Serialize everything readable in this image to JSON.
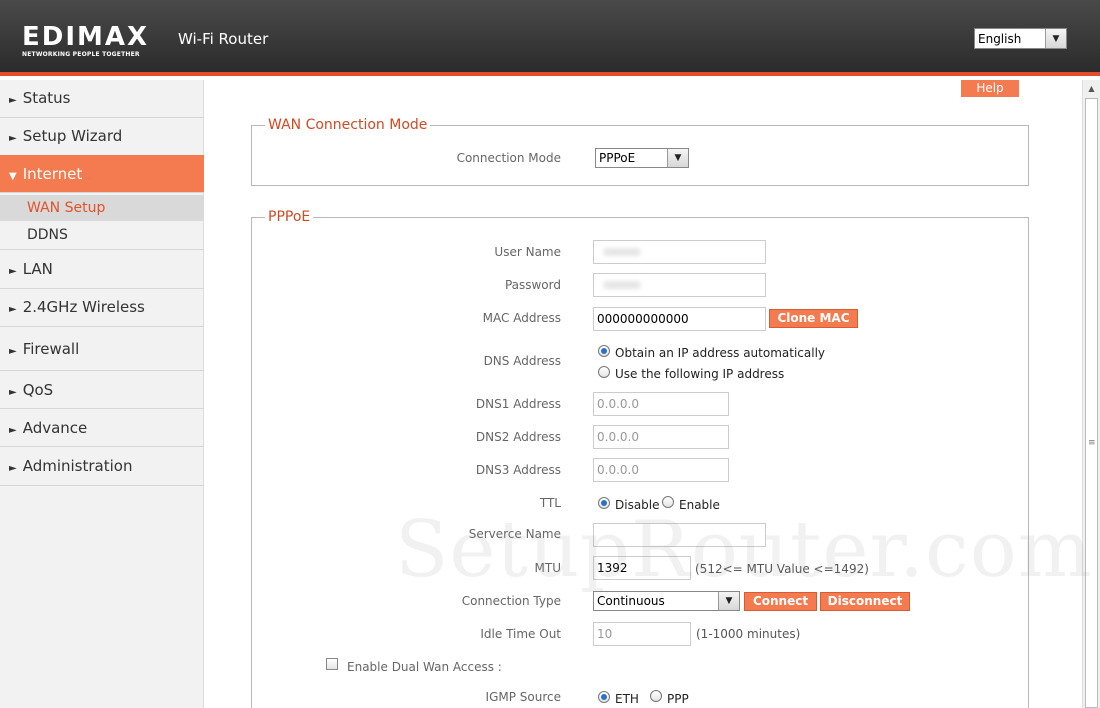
{
  "header": {
    "logo_text": "EDIMAX",
    "logo_tagline": "NETWORKING PEOPLE TOGETHER",
    "product_name": "Wi-Fi Router",
    "language": {
      "selected": "English"
    }
  },
  "sidebar": {
    "items": [
      {
        "label": "Status"
      },
      {
        "label": "Setup Wizard"
      },
      {
        "label": "Internet"
      },
      {
        "label": "LAN"
      },
      {
        "label": "2.4GHz Wireless"
      },
      {
        "label": "Firewall"
      },
      {
        "label": "QoS"
      },
      {
        "label": "Advance"
      },
      {
        "label": "Administration"
      }
    ],
    "subitems": [
      {
        "label": "WAN Setup"
      },
      {
        "label": "DDNS"
      }
    ],
    "expanded_item": "Internet",
    "selected_subitem": "WAN Setup"
  },
  "help_label": "Help",
  "wan_mode": {
    "legend": "WAN Connection Mode",
    "connection_mode_label": "Connection Mode",
    "connection_mode_value": "PPPoE"
  },
  "pppoe": {
    "legend": "PPPoE",
    "user_name_label": "User Name",
    "password_label": "Password",
    "mac_label": "MAC Address",
    "mac_value": "000000000000",
    "clone_mac_label": "Clone MAC",
    "dns_label": "DNS  Address",
    "dns_auto_label": "Obtain an IP address automatically",
    "dns_manual_label": "Use the following IP address",
    "dns1_label": "DNS1  Address",
    "dns1_value": "0.0.0.0",
    "dns2_label": "DNS2  Address",
    "dns2_value": "0.0.0.0",
    "dns3_label": "DNS3  Address",
    "dns3_value": "0.0.0.0",
    "ttl_label": "TTL",
    "ttl_disable_label": "Disable",
    "ttl_enable_label": "Enable",
    "service_name_label": "Serverce Name",
    "mtu_label": "MTU",
    "mtu_value": "1392",
    "mtu_hint": "(512<= MTU  Value <=1492)",
    "connection_type_label": "Connection Type",
    "connection_type_value": "Continuous",
    "connect_label": "Connect",
    "disconnect_label": "Disconnect",
    "idle_timeout_label": "Idle Time Out",
    "idle_timeout_value": "10",
    "idle_timeout_hint": "(1-1000 minutes)",
    "dual_wan_label": "Enable  Dual Wan Access  :",
    "igmp_label": "IGMP Source",
    "igmp_eth_label": "ETH",
    "igmp_ppp_label": "PPP"
  },
  "watermark": "SetupRouter.com",
  "colors": {
    "accent": "#f47a4f",
    "legend": "#d04a24",
    "header_bg": "#333333",
    "radio_selected": "#2a72c9"
  },
  "icons": [
    "triangle-right-icon",
    "triangle-down-icon",
    "chevron-down-icon",
    "scroll-up-icon"
  ]
}
